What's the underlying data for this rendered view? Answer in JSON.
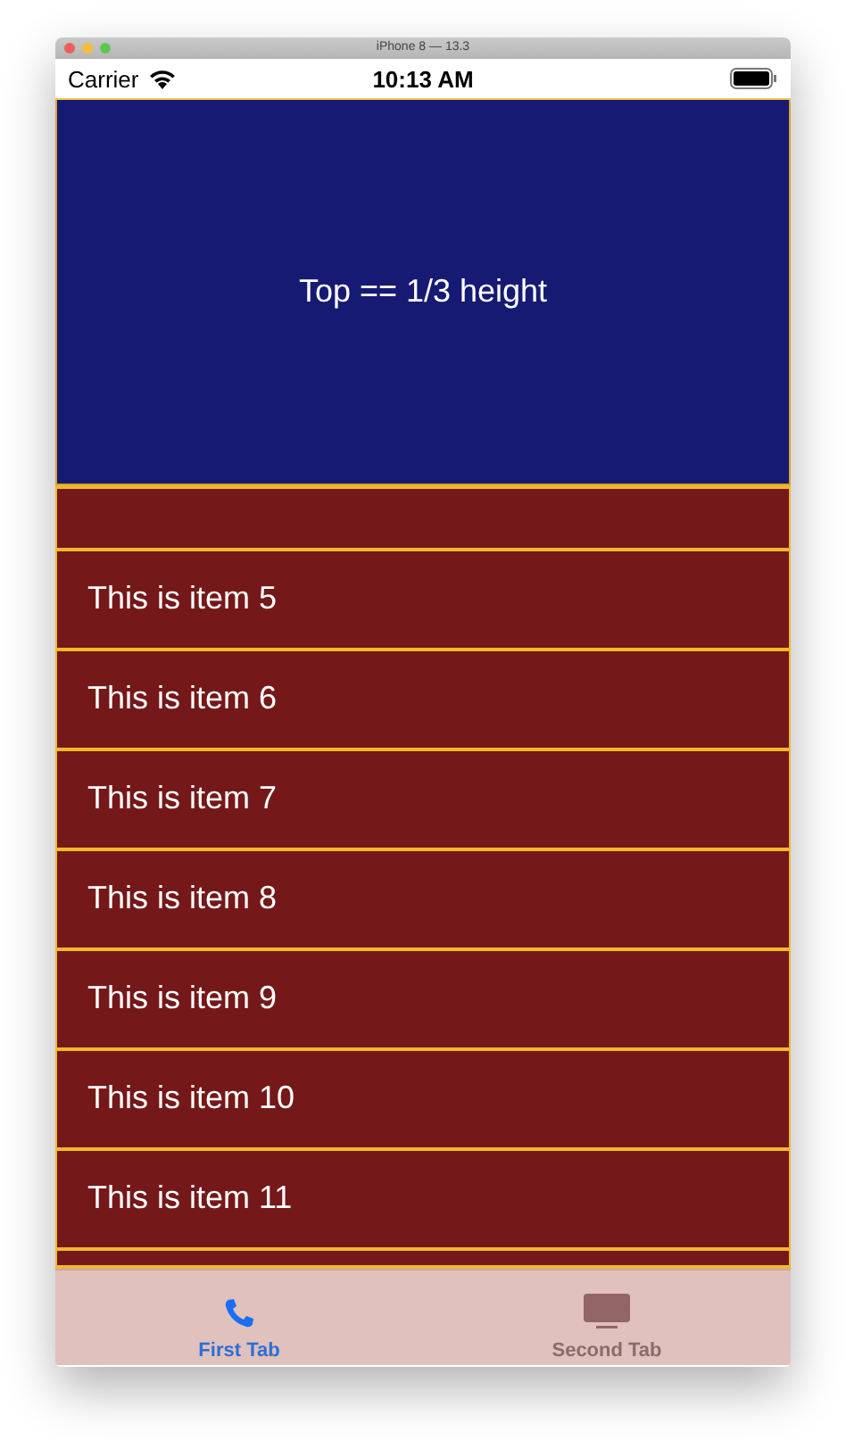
{
  "window": {
    "title": "iPhone 8 — 13.3"
  },
  "status_bar": {
    "carrier": "Carrier",
    "time": "10:13 AM"
  },
  "top_panel": {
    "label": "Top == 1/3 height"
  },
  "list": {
    "items": [
      {
        "kind": "partial"
      },
      {
        "kind": "item",
        "label": "This is item 5"
      },
      {
        "kind": "item",
        "label": "This is item 6"
      },
      {
        "kind": "item",
        "label": "This is item 7"
      },
      {
        "kind": "item",
        "label": "This is item 8"
      },
      {
        "kind": "item",
        "label": "This is item 9"
      },
      {
        "kind": "item",
        "label": "This is item 10"
      },
      {
        "kind": "item",
        "label": "This is item 11"
      },
      {
        "kind": "partial"
      }
    ]
  },
  "tabs": [
    {
      "label": "First Tab",
      "kind": "phone",
      "selected": true
    },
    {
      "label": "Second Tab",
      "kind": "screen",
      "selected": false
    }
  ]
}
